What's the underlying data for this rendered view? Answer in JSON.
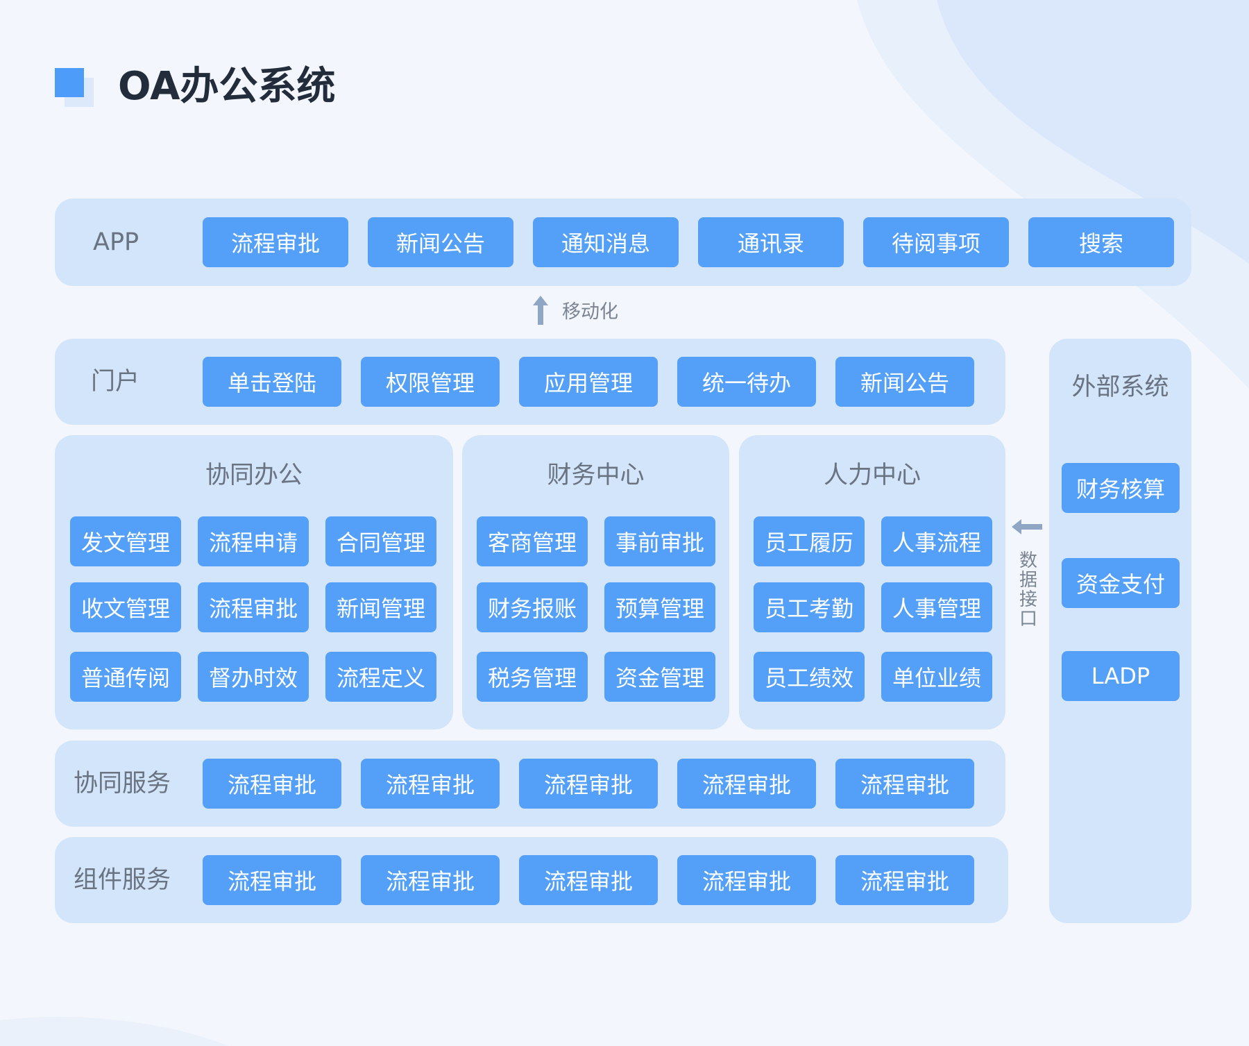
{
  "title": "OA办公系统",
  "app": {
    "label": "APP",
    "items": [
      "流程审批",
      "新闻公告",
      "通知消息",
      "通讯录",
      "待阅事项",
      "搜索"
    ]
  },
  "mobile_note": "移动化",
  "portal": {
    "label": "门户",
    "items": [
      "单击登陆",
      "权限管理",
      "应用管理",
      "统一待办",
      "新闻公告"
    ]
  },
  "collab_office": {
    "title": "协同办公",
    "items": [
      "发文管理",
      "流程申请",
      "合同管理",
      "收文管理",
      "流程审批",
      "新闻管理",
      "普通传阅",
      "督办时效",
      "流程定义"
    ]
  },
  "finance": {
    "title": "财务中心",
    "items": [
      "客商管理",
      "事前审批",
      "财务报账",
      "预算管理",
      "税务管理",
      "资金管理"
    ]
  },
  "hr": {
    "title": "人力中心",
    "items": [
      "员工履历",
      "人事流程",
      "员工考勤",
      "人事管理",
      "员工绩效",
      "单位业绩"
    ]
  },
  "collab_service": {
    "label": "协同服务",
    "items": [
      "流程审批",
      "流程审批",
      "流程审批",
      "流程审批",
      "流程审批"
    ]
  },
  "component_service": {
    "label": "组件服务",
    "items": [
      "流程审批",
      "流程审批",
      "流程审批",
      "流程审批",
      "流程审批"
    ]
  },
  "external": {
    "title": "外部系统",
    "items": [
      "财务核算",
      "资金支付",
      "LADP"
    ]
  },
  "data_interface_note": "数据接口",
  "colors": {
    "background": "#f3f7fd",
    "panel": "#d3e5fb",
    "button": "#54a0f9",
    "title_icon": "#4e9cf9",
    "label_text": "#6a7381",
    "title_text": "#222c3a"
  }
}
